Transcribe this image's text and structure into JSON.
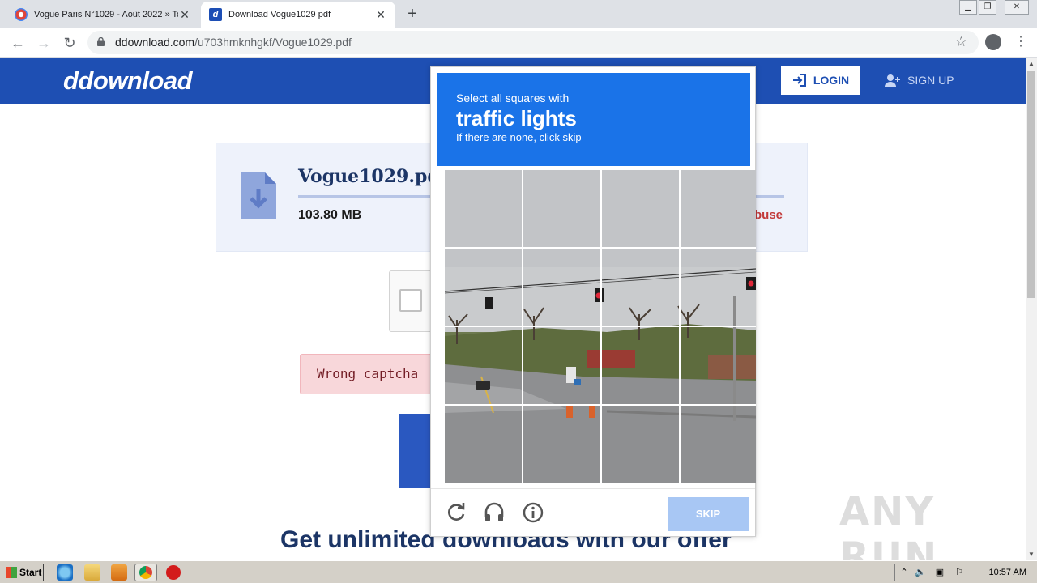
{
  "browser": {
    "tabs": [
      {
        "title": "Vogue Paris N°1029 - Août 2022 » To",
        "active": false
      },
      {
        "title": "Download Vogue1029 pdf",
        "active": true
      }
    ],
    "url_domain": "ddownload.com",
    "url_path": "/u703hmknhgkf/Vogue1029.pdf",
    "new_tab": "+",
    "close": "✕"
  },
  "site": {
    "logo": "ddownload",
    "login": "LOGIN",
    "signup": "SIGN UP",
    "brand_color": "#1e4fb3"
  },
  "file": {
    "name": "Vogue1029.pdf",
    "size": "103.80 MB",
    "abuse": "buse"
  },
  "messages": {
    "wrong_captcha": "Wrong captcha",
    "promo": "Get unlimited downloads with our offer"
  },
  "captcha": {
    "instruction": "Select all squares with",
    "target": "traffic lights",
    "hint": "If there are none, click skip",
    "skip": "SKIP",
    "tools": [
      "reload-icon",
      "audio-icon",
      "info-icon"
    ]
  },
  "watermark": "ANY RUN",
  "taskbar": {
    "start": "Start",
    "clock": "10:57 AM",
    "tray_arrow": "⌃"
  }
}
